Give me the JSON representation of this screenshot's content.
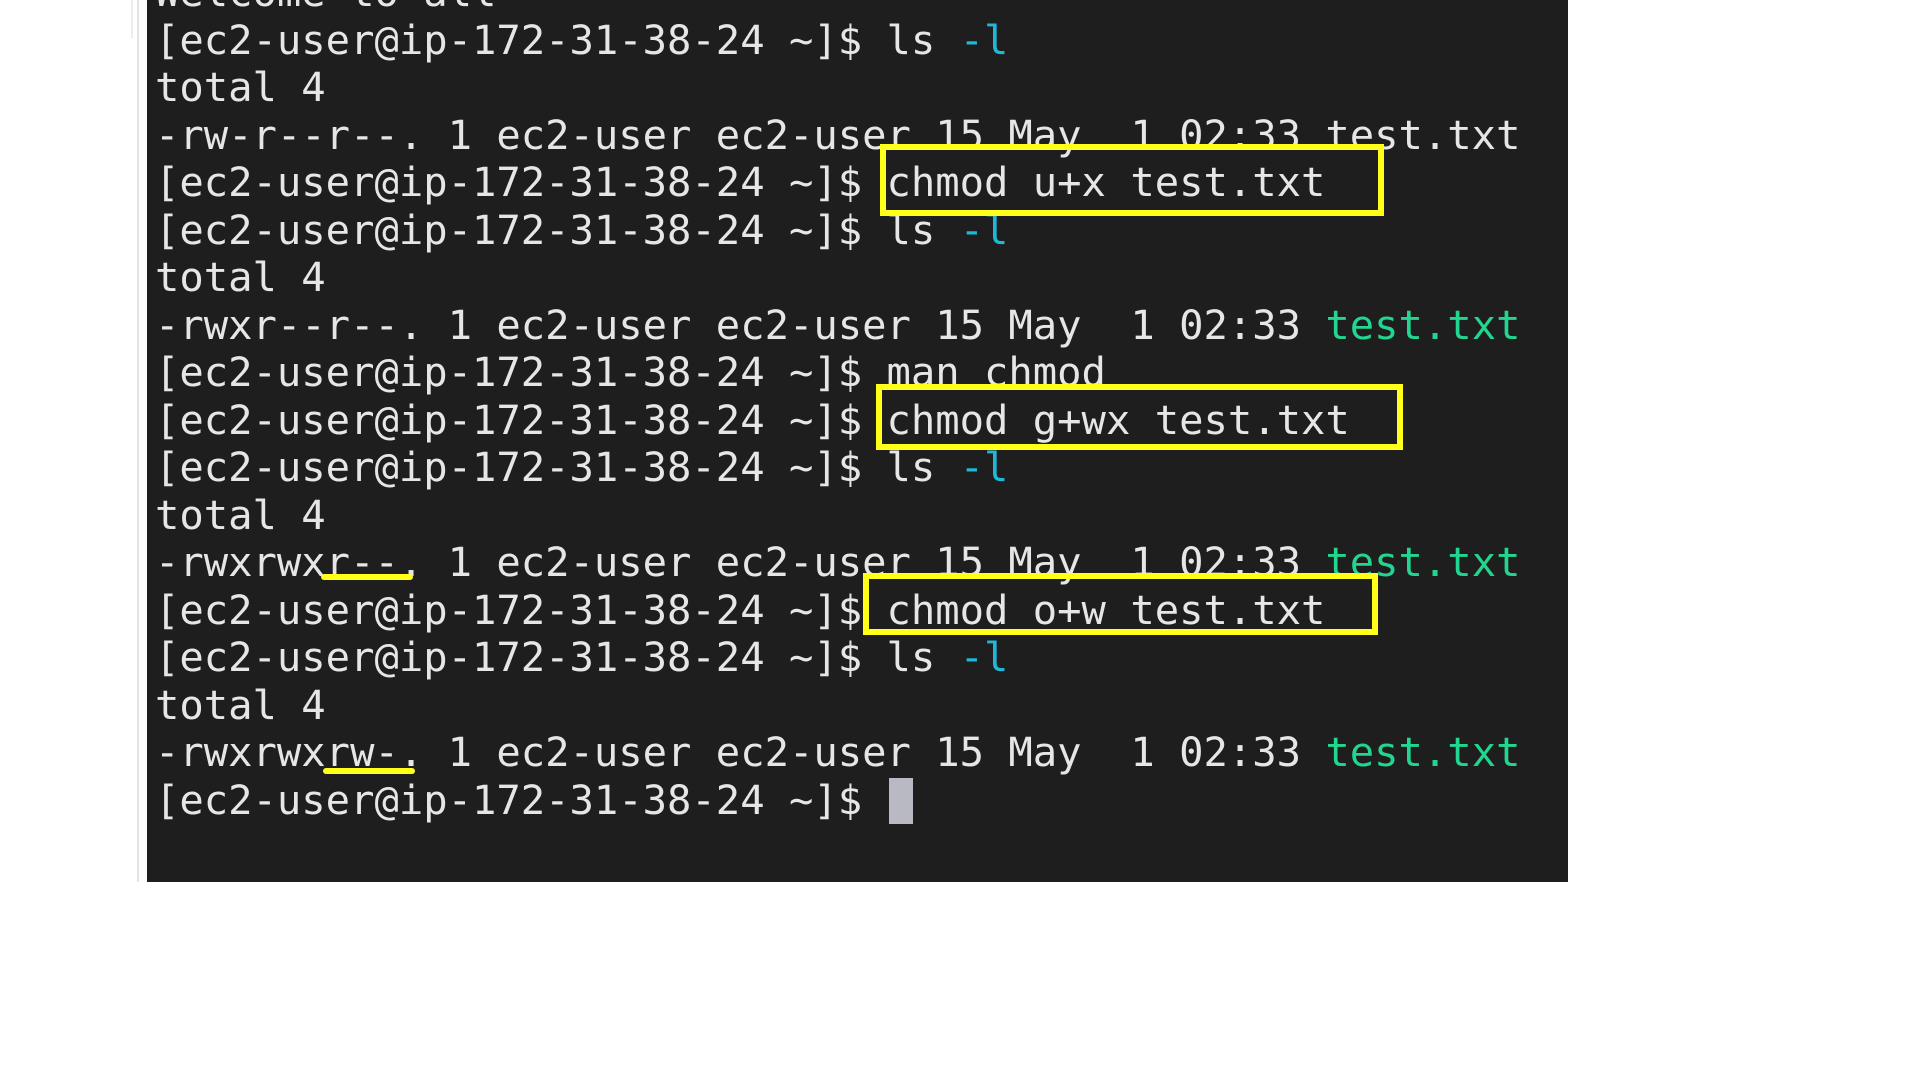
{
  "terminal": {
    "lines": [
      {
        "parts": [
          {
            "text": "Welcome to all"
          }
        ]
      },
      {
        "parts": [
          {
            "text": "[ec2-user@ip-172-31-38-24 ~]$ ls "
          },
          {
            "text": "-l",
            "style": "flag"
          }
        ]
      },
      {
        "parts": [
          {
            "text": "total 4"
          }
        ]
      },
      {
        "parts": [
          {
            "text": "-rw-r--r--. 1 ec2-user ec2-user 15 May  1 02:33 test.txt"
          }
        ]
      },
      {
        "parts": [
          {
            "text": "[ec2-user@ip-172-31-38-24 ~]$ chmod u+x test.txt"
          }
        ]
      },
      {
        "parts": [
          {
            "text": "[ec2-user@ip-172-31-38-24 ~]$ ls "
          },
          {
            "text": "-l",
            "style": "flag"
          }
        ]
      },
      {
        "parts": [
          {
            "text": "total 4"
          }
        ]
      },
      {
        "parts": [
          {
            "text": "-rwxr--r--. 1 ec2-user ec2-user 15 May  1 02:33 "
          },
          {
            "text": "test.txt",
            "style": "exec"
          }
        ]
      },
      {
        "parts": [
          {
            "text": "[ec2-user@ip-172-31-38-24 ~]$ man chmod"
          }
        ]
      },
      {
        "parts": [
          {
            "text": "[ec2-user@ip-172-31-38-24 ~]$ chmod g+wx test.txt"
          }
        ]
      },
      {
        "parts": [
          {
            "text": "[ec2-user@ip-172-31-38-24 ~]$ ls "
          },
          {
            "text": "-l",
            "style": "flag"
          }
        ]
      },
      {
        "parts": [
          {
            "text": "total 4"
          }
        ]
      },
      {
        "parts": [
          {
            "text": "-rwxrwxr--. 1 ec2-user ec2-user 15 May  1 02:33 "
          },
          {
            "text": "test.txt",
            "style": "exec"
          }
        ]
      },
      {
        "parts": [
          {
            "text": "[ec2-user@ip-172-31-38-24 ~]$ chmod o+w test.txt"
          }
        ]
      },
      {
        "parts": [
          {
            "text": "[ec2-user@ip-172-31-38-24 ~]$ ls "
          },
          {
            "text": "-l",
            "style": "flag"
          }
        ]
      },
      {
        "parts": [
          {
            "text": "total 4"
          }
        ]
      },
      {
        "parts": [
          {
            "text": "-rwxrwxrw-. 1 ec2-user ec2-user 15 May  1 02:33 "
          },
          {
            "text": "test.txt",
            "style": "exec"
          }
        ]
      },
      {
        "parts": [
          {
            "text": "[ec2-user@ip-172-31-38-24 ~]$ "
          }
        ],
        "cursor": true
      }
    ]
  },
  "colors": {
    "background": "#1e1e1e",
    "text": "#e6e6e6",
    "flag": "#1fb8d8",
    "executable": "#22d68f",
    "highlight": "#ffff1a",
    "cursor": "#b9b9c4"
  }
}
